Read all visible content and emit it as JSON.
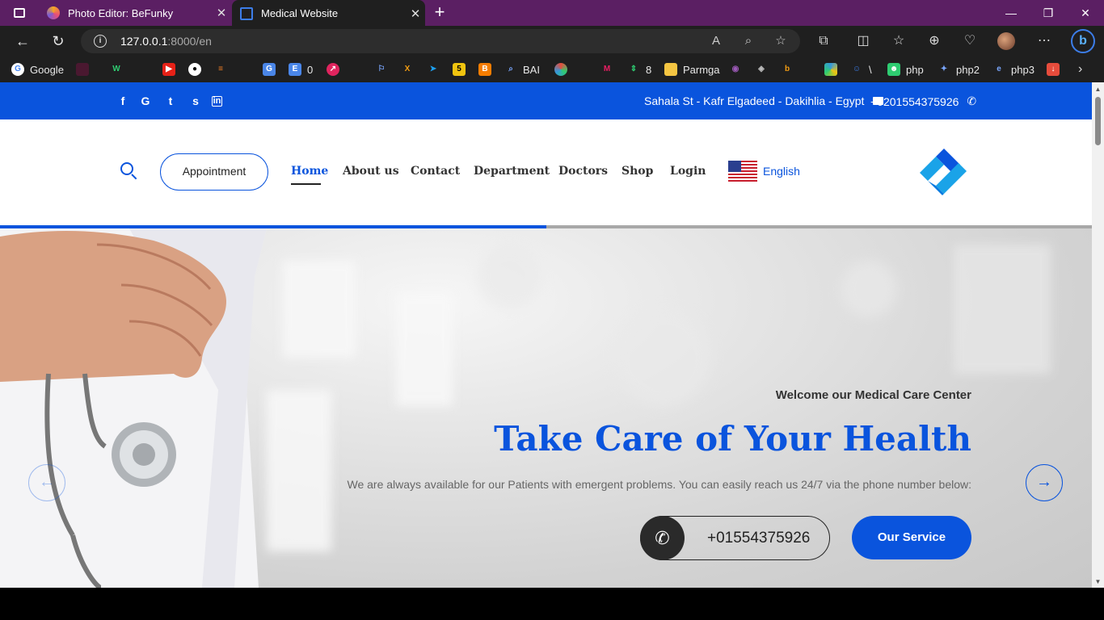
{
  "browser": {
    "tabs": [
      {
        "title": "Photo Editor: BeFunky"
      },
      {
        "title": "Medical Website"
      }
    ],
    "url_host": "127.0.0.1",
    "url_path": ":8000/en",
    "bookmarks": [
      {
        "label": "Google"
      },
      {
        "label": "0"
      },
      {
        "label": "BAI"
      },
      {
        "label": "8"
      },
      {
        "label": "Parmga"
      },
      {
        "label": "\\"
      },
      {
        "label": "php"
      },
      {
        "label": "php2"
      },
      {
        "label": "php3"
      }
    ]
  },
  "topbar": {
    "address": "Sahala St - Kafr Elgadeed - Dakihlia - Egypt",
    "phone": "+0201554375926",
    "social": [
      "f",
      "G",
      "t",
      "s",
      "in"
    ]
  },
  "nav": {
    "appointment": "Appointment",
    "items": [
      "Home",
      "About us",
      "Contact",
      "Department",
      "Doctors",
      "Shop",
      "Login"
    ],
    "language": "English"
  },
  "slider": {
    "progress": 0.5
  },
  "hero": {
    "welcome": "Welcome our Medical Care Center",
    "title": "Take Care of Your Health",
    "description": "We are always available for our Patients with emergent problems. You can easily reach us 24/7 via the phone number below:",
    "phone": "+01554375926",
    "service_button": "Our Service"
  },
  "colors": {
    "brand_blue": "#0a54dd",
    "titlebar": "#5b1f63"
  }
}
